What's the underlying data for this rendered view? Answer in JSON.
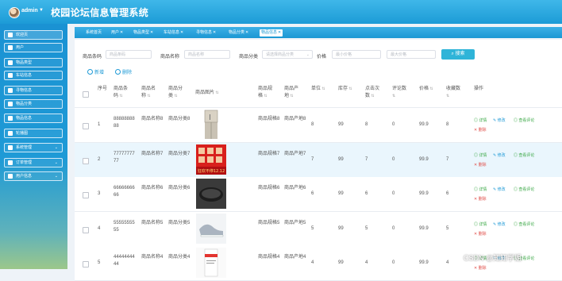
{
  "header": {
    "username": "admin",
    "title": "校园论坛信息管理系统"
  },
  "sidebar": [
    {
      "label": "欢迎页",
      "active": true,
      "chev": false
    },
    {
      "label": "用户",
      "chev": false
    },
    {
      "label": "物品类型",
      "chev": false
    },
    {
      "label": "车站信息",
      "chev": false
    },
    {
      "label": "寻物信息",
      "chev": false
    },
    {
      "label": "物品分类",
      "chev": false
    },
    {
      "label": "物品信息",
      "chev": false
    },
    {
      "label": "轮播图",
      "chev": false
    },
    {
      "label": "系统管理",
      "chev": true
    },
    {
      "label": "订单管理",
      "chev": true
    },
    {
      "label": "用户信息",
      "chev": true
    }
  ],
  "tabs": [
    {
      "label": "系统首页",
      "x": false
    },
    {
      "label": "用户",
      "x": true
    },
    {
      "label": "物品类型",
      "x": true
    },
    {
      "label": "车站信息",
      "x": true
    },
    {
      "label": "寻物信息",
      "x": true
    },
    {
      "label": "物品分类",
      "x": true
    },
    {
      "label": "物品信息",
      "x": true,
      "active": true
    }
  ],
  "filters": {
    "code_label": "商品条码",
    "code_ph": "商品条码",
    "name_label": "商品名称",
    "name_ph": "商品名称",
    "cat_label": "商品分类",
    "cat_ph": "请选择商品分类",
    "price_label": "价格",
    "price_min_ph": "最小价格",
    "price_max_ph": "最大价格",
    "search_btn": "搜索"
  },
  "actions": {
    "add": "新增",
    "delete": "删除"
  },
  "columns": [
    "序号",
    "商品条码",
    "商品名称",
    "商品分类",
    "商品图片",
    "商品规格",
    "商品产地",
    "单位",
    "库存",
    "点击次数",
    "评论数",
    "价格",
    "收藏数",
    "操作"
  ],
  "rows": [
    {
      "idx": "1",
      "code": "8888888888",
      "name": "商品名称8",
      "cat": "商品分类8",
      "spec": "商品规格8",
      "origin": "商品产地8",
      "unit": "8",
      "stock": "99",
      "clicks": "8",
      "comments": "0",
      "price": "99.9",
      "fav": "8",
      "img": "fridge"
    },
    {
      "idx": "2",
      "code": "7777777777",
      "name": "商品名称7",
      "cat": "商品分类7",
      "spec": "商品规格7",
      "origin": "商品产地7",
      "unit": "7",
      "stock": "99",
      "clicks": "7",
      "comments": "0",
      "price": "99.9",
      "fav": "7",
      "img": "promo"
    },
    {
      "idx": "3",
      "code": "6666666666",
      "name": "商品名称6",
      "cat": "商品分类6",
      "spec": "商品规格6",
      "origin": "商品产地6",
      "unit": "6",
      "stock": "99",
      "clicks": "6",
      "comments": "0",
      "price": "99.9",
      "fav": "6",
      "img": "speaker"
    },
    {
      "idx": "4",
      "code": "5555555555",
      "name": "商品名称5",
      "cat": "商品分类5",
      "spec": "商品规格5",
      "origin": "商品产地5",
      "unit": "5",
      "stock": "99",
      "clicks": "5",
      "comments": "0",
      "price": "99.9",
      "fav": "5",
      "img": "shoes"
    },
    {
      "idx": "5",
      "code": "4444444444",
      "name": "商品名称4",
      "cat": "商品分类4",
      "spec": "商品规格4",
      "origin": "商品产地4",
      "unit": "4",
      "stock": "99",
      "clicks": "4",
      "comments": "0",
      "price": "99.9",
      "fav": "4",
      "img": "box"
    }
  ],
  "row_ops": {
    "detail": "详情",
    "edit": "修改",
    "comments": "查看评论",
    "delete": "删除"
  },
  "promo_text": "狂欢不停12.12",
  "watermark": "CSDN @知知学姐"
}
